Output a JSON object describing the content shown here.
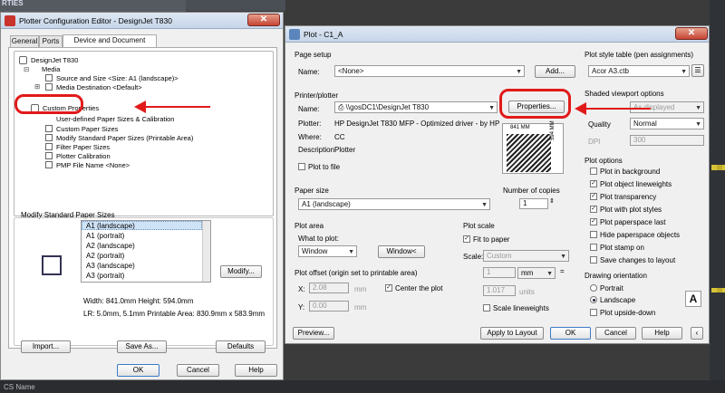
{
  "background": {
    "title": "RTIES",
    "status": "CS Name"
  },
  "left_dialog": {
    "title": "Plotter Configuration Editor - DesignJet T830",
    "tabs": [
      "General",
      "Ports",
      "Device and Document Settings"
    ],
    "tree": {
      "root": "DesignJet T830",
      "media": "Media",
      "source_size": "Source and Size <Size: A1 (landscape)>",
      "media_destination": "Media Destination <Default>",
      "custom_properties": "Custom Properties",
      "user_defined": "User-defined Paper Sizes & Calibration",
      "custom_paper_sizes": "Custom Paper Sizes",
      "modify_standard": "Modify Standard Paper Sizes (Printable Area)",
      "filter_paper": "Filter Paper Sizes",
      "plotter_calibration": "Plotter Calibration",
      "pmp_file": "PMP File Name <None>"
    },
    "modify_section": {
      "heading": "Modify Standard Paper Sizes",
      "items": [
        "A1 (landscape)",
        "A1 (portrait)",
        "A2 (landscape)",
        "A2 (portrait)",
        "A3 (landscape)",
        "A3 (portrait)"
      ],
      "modify_button": "Modify...",
      "width_height": "Width: 841.0mm Height: 594.0mm",
      "lr_area": "LR: 5.0mm, 5.1mm  Printable Area: 830.9mm x 583.9mm"
    },
    "buttons": {
      "import": "Import...",
      "save_as": "Save As...",
      "defaults": "Defaults",
      "ok": "OK",
      "cancel": "Cancel",
      "help": "Help"
    }
  },
  "right_dialog": {
    "title": "Plot - C1_A",
    "page_setup": {
      "heading": "Page setup",
      "name_label": "Name:",
      "name_value": "<None>",
      "add_button": "Add..."
    },
    "printer": {
      "heading": "Printer/plotter",
      "name_label": "Name:",
      "name_value": "\\\\gosDC1\\DesignJet T830",
      "properties_button": "Properties...",
      "plotter_label": "Plotter:",
      "plotter_value": "HP DesignJet T830 MFP - Optimized driver - by HP",
      "where_label": "Where:",
      "where_value": "CC",
      "description_label": "Description:",
      "description_value": "Plotter",
      "plot_to_file": "Plot to file",
      "preview_width": "841 MM",
      "preview_height": "594 MM"
    },
    "paper_size": {
      "heading": "Paper size",
      "value": "A1 (landscape)"
    },
    "copies": {
      "heading": "Number of copies",
      "value": "1"
    },
    "plot_area": {
      "heading": "Plot area",
      "what_label": "What to plot:",
      "what_value": "Window",
      "window_button": "Window<"
    },
    "plot_scale": {
      "heading": "Plot scale",
      "fit_to_paper": "Fit to paper",
      "scale_label": "Scale:",
      "scale_value": "Custom",
      "value1": "1",
      "unit": "mm",
      "value2": "1.017",
      "units_label": "units",
      "scale_lineweights": "Scale lineweights"
    },
    "plot_offset": {
      "heading": "Plot offset (origin set to printable area)",
      "x_label": "X:",
      "x_value": "2.08",
      "y_label": "Y:",
      "y_value": "0.00",
      "unit": "mm",
      "center": "Center the plot"
    },
    "style_table": {
      "heading": "Plot style table (pen assignments)",
      "value": "Acor A3.ctb"
    },
    "shaded": {
      "heading": "Shaded viewport options",
      "shade_value": "As displayed",
      "quality_label": "Quality",
      "quality_value": "Normal",
      "dpi_label": "DPI",
      "dpi_value": "300"
    },
    "plot_options": {
      "heading": "Plot options",
      "items": [
        {
          "label": "Plot in background",
          "checked": false
        },
        {
          "label": "Plot object lineweights",
          "checked": true
        },
        {
          "label": "Plot transparency",
          "checked": true
        },
        {
          "label": "Plot with plot styles",
          "checked": true
        },
        {
          "label": "Plot paperspace last",
          "checked": true
        },
        {
          "label": "Hide paperspace objects",
          "checked": false
        },
        {
          "label": "Plot stamp on",
          "checked": false
        },
        {
          "label": "Save changes to layout",
          "checked": false
        }
      ]
    },
    "orientation": {
      "heading": "Drawing orientation",
      "portrait": "Portrait",
      "landscape": "Landscape",
      "upside_down": "Plot upside-down",
      "icon_letter": "A"
    },
    "buttons": {
      "preview": "Preview...",
      "apply": "Apply to Layout",
      "ok": "OK",
      "cancel": "Cancel",
      "help": "Help"
    }
  }
}
